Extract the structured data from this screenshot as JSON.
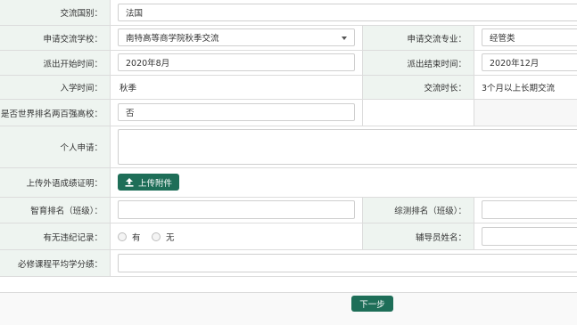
{
  "form": {
    "country": {
      "label": "交流国别：",
      "value": "法国"
    },
    "school": {
      "label": "申请交流学校：",
      "value": "南特高等商学院秋季交流"
    },
    "major": {
      "label": "申请交流专业：",
      "value": "经管类"
    },
    "start": {
      "label": "派出开始时间：",
      "value": "2020年8月"
    },
    "end": {
      "label": "派出结束时间：",
      "value": "2020年12月"
    },
    "entry": {
      "label": "入学时间：",
      "value": "秋季"
    },
    "duration": {
      "label": "交流时长：",
      "value": "3个月以上长期交流"
    },
    "top200": {
      "label": "是否世界排名两百强高校：",
      "value": "否"
    },
    "statement": {
      "label": "个人申请：",
      "value": ""
    },
    "upload": {
      "label": "上传外语成绩证明：",
      "button": "上传附件"
    },
    "moral_rank": {
      "label": "智育排名（班级）：",
      "value": ""
    },
    "overall_rank": {
      "label": "综测排名（班级）：",
      "value": ""
    },
    "violation": {
      "label": "有无违纪记录：",
      "options": [
        "有",
        "无"
      ]
    },
    "counselor": {
      "label": "辅导员姓名：",
      "value": ""
    },
    "gpa": {
      "label": "必修课程平均学分绩：",
      "value": ""
    }
  },
  "footer": {
    "next_label": "下一步"
  },
  "colors": {
    "accent": "#1e6e58",
    "label_bg": "#eef4f0"
  }
}
